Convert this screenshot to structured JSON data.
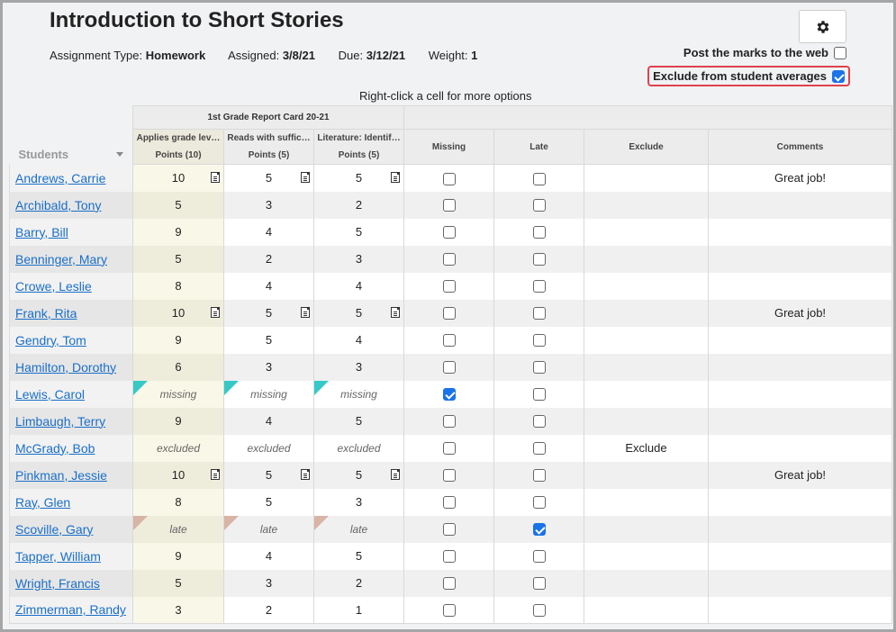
{
  "header": {
    "title": "Introduction to Short Stories",
    "assignment_type_label": "Assignment Type:",
    "assignment_type": "Homework",
    "assigned_label": "Assigned:",
    "assigned": "3/8/21",
    "due_label": "Due:",
    "due": "3/12/21",
    "weight_label": "Weight:",
    "weight": "1"
  },
  "settings": {
    "gear_icon": "gear-icon"
  },
  "options": {
    "post_label": "Post the marks to the web",
    "post_checked": false,
    "exclude_label": "Exclude from student averages",
    "exclude_checked": true,
    "highlight_color": "#e0424d"
  },
  "hint": "Right-click a cell for more options",
  "grid": {
    "students_header": "Students",
    "group_header": "1st Grade Report Card 20-21",
    "columns": [
      {
        "title": "Applies grade lev…",
        "points": "Points (10)"
      },
      {
        "title": "Reads with suffic…",
        "points": "Points (5)"
      },
      {
        "title": "Literature: Identif…",
        "points": "Points (5)"
      }
    ],
    "missing_header": "Missing",
    "late_header": "Late",
    "exclude_header": "Exclude",
    "comments_header": "Comments",
    "flag_colors": {
      "missing": "#36c9c6",
      "late": "#d8b4a6"
    },
    "rows": [
      {
        "name": "Andrews, Carrie",
        "scores": [
          "10",
          "5",
          "5"
        ],
        "notes": true,
        "status": "",
        "missing": false,
        "late": false,
        "exclude": "",
        "comment": "Great job!"
      },
      {
        "name": "Archibald, Tony",
        "scores": [
          "5",
          "3",
          "2"
        ],
        "notes": false,
        "status": "",
        "missing": false,
        "late": false,
        "exclude": "",
        "comment": ""
      },
      {
        "name": "Barry, Bill",
        "scores": [
          "9",
          "4",
          "5"
        ],
        "notes": false,
        "status": "",
        "missing": false,
        "late": false,
        "exclude": "",
        "comment": ""
      },
      {
        "name": "Benninger, Mary",
        "scores": [
          "5",
          "2",
          "3"
        ],
        "notes": false,
        "status": "",
        "missing": false,
        "late": false,
        "exclude": "",
        "comment": ""
      },
      {
        "name": "Crowe, Leslie",
        "scores": [
          "8",
          "4",
          "4"
        ],
        "notes": false,
        "status": "",
        "missing": false,
        "late": false,
        "exclude": "",
        "comment": ""
      },
      {
        "name": "Frank, Rita",
        "scores": [
          "10",
          "5",
          "5"
        ],
        "notes": true,
        "status": "",
        "missing": false,
        "late": false,
        "exclude": "",
        "comment": "Great job!"
      },
      {
        "name": "Gendry, Tom",
        "scores": [
          "9",
          "5",
          "4"
        ],
        "notes": false,
        "status": "",
        "missing": false,
        "late": false,
        "exclude": "",
        "comment": ""
      },
      {
        "name": "Hamilton, Dorothy",
        "scores": [
          "6",
          "3",
          "3"
        ],
        "notes": false,
        "status": "",
        "missing": false,
        "late": false,
        "exclude": "",
        "comment": ""
      },
      {
        "name": "Lewis, Carol",
        "scores": [
          "missing",
          "missing",
          "missing"
        ],
        "notes": false,
        "status": "missing",
        "missing": true,
        "late": false,
        "exclude": "",
        "comment": ""
      },
      {
        "name": "Limbaugh, Terry",
        "scores": [
          "9",
          "4",
          "5"
        ],
        "notes": false,
        "status": "",
        "missing": false,
        "late": false,
        "exclude": "",
        "comment": ""
      },
      {
        "name": "McGrady, Bob",
        "scores": [
          "excluded",
          "excluded",
          "excluded"
        ],
        "notes": false,
        "status": "excluded",
        "missing": false,
        "late": false,
        "exclude": "Exclude",
        "comment": ""
      },
      {
        "name": "Pinkman, Jessie",
        "scores": [
          "10",
          "5",
          "5"
        ],
        "notes": true,
        "status": "",
        "missing": false,
        "late": false,
        "exclude": "",
        "comment": "Great job!"
      },
      {
        "name": "Ray, Glen",
        "scores": [
          "8",
          "5",
          "3"
        ],
        "notes": false,
        "status": "",
        "missing": false,
        "late": false,
        "exclude": "",
        "comment": ""
      },
      {
        "name": "Scoville, Gary",
        "scores": [
          "late",
          "late",
          "late"
        ],
        "notes": false,
        "status": "late",
        "missing": false,
        "late": true,
        "exclude": "",
        "comment": ""
      },
      {
        "name": "Tapper, William",
        "scores": [
          "9",
          "4",
          "5"
        ],
        "notes": false,
        "status": "",
        "missing": false,
        "late": false,
        "exclude": "",
        "comment": ""
      },
      {
        "name": "Wright, Francis",
        "scores": [
          "5",
          "3",
          "2"
        ],
        "notes": false,
        "status": "",
        "missing": false,
        "late": false,
        "exclude": "",
        "comment": ""
      },
      {
        "name": "Zimmerman, Randy",
        "scores": [
          "3",
          "2",
          "1"
        ],
        "notes": false,
        "status": "",
        "missing": false,
        "late": false,
        "exclude": "",
        "comment": ""
      }
    ]
  }
}
